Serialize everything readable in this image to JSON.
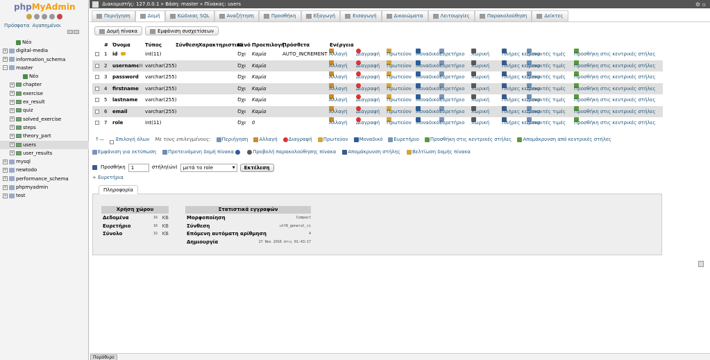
{
  "sidebar": {
    "logo_a": "php",
    "logo_b": "MyAdmin",
    "recent": "Πρόσφατα",
    "favorites": "Αγαπημένοι",
    "tree": [
      {
        "label": "Νέο",
        "type": "new",
        "depth": 1,
        "toggle": ""
      },
      {
        "label": "digital-media",
        "type": "db",
        "depth": 0,
        "toggle": "+"
      },
      {
        "label": "information_schema",
        "type": "db",
        "depth": 0,
        "toggle": "+"
      },
      {
        "label": "master",
        "type": "db",
        "depth": 0,
        "toggle": "−"
      },
      {
        "label": "Νέο",
        "type": "new",
        "depth": 2,
        "toggle": ""
      },
      {
        "label": "chapter",
        "type": "tb",
        "depth": 1,
        "toggle": "+"
      },
      {
        "label": "exercise",
        "type": "tb",
        "depth": 1,
        "toggle": "+"
      },
      {
        "label": "ex_result",
        "type": "tb",
        "depth": 1,
        "toggle": "+"
      },
      {
        "label": "quiz",
        "type": "tb",
        "depth": 1,
        "toggle": "+"
      },
      {
        "label": "solved_exercise",
        "type": "tb",
        "depth": 1,
        "toggle": "+"
      },
      {
        "label": "steps",
        "type": "tb",
        "depth": 1,
        "toggle": "+"
      },
      {
        "label": "theory_part",
        "type": "tb",
        "depth": 1,
        "toggle": "+"
      },
      {
        "label": "users",
        "type": "tb",
        "depth": 1,
        "toggle": "+",
        "selected": true
      },
      {
        "label": "user_results",
        "type": "tb",
        "depth": 1,
        "toggle": "+"
      },
      {
        "label": "mysql",
        "type": "db",
        "depth": 0,
        "toggle": "+"
      },
      {
        "label": "newtodo",
        "type": "db",
        "depth": 0,
        "toggle": "+"
      },
      {
        "label": "performance_schema",
        "type": "db",
        "depth": 0,
        "toggle": "+"
      },
      {
        "label": "phpmyadmin",
        "type": "db",
        "depth": 0,
        "toggle": "+"
      },
      {
        "label": "test",
        "type": "db",
        "depth": 0,
        "toggle": "+"
      }
    ]
  },
  "breadcrumb": {
    "server": "Διακομιστής: 127.0.0.1",
    "sep1": "»",
    "db": "Βάση: master",
    "sep2": "»",
    "table": "Πίνακας: users"
  },
  "tabs": [
    "Περιήγηση",
    "Δομή",
    "Κώδικας SQL",
    "Αναζήτηση",
    "Προσθήκη",
    "Εξαγωγή",
    "Εισαγωγή",
    "Δικαιώματα",
    "Λειτουργίες",
    "Παρακολούθηση",
    "Δείκτες"
  ],
  "subtabs": [
    "Δομή πίνακα",
    "Εμφάνιση συσχετίσεων"
  ],
  "columns": {
    "num": "#",
    "name": "Όνομα",
    "type": "Τύπος",
    "collation": "Σύνθεση",
    "attributes": "Χαρακτηριστικά",
    "null": "Κενό",
    "default": "Προεπιλογή",
    "extra": "Πρόσθετα",
    "action": "Ενέργεια"
  },
  "actions": [
    "Αλλαγή",
    "Διαγραφή",
    "Πρωτεύον",
    "Μοναδικό",
    "Ευρετήριο",
    "Χωρική",
    "Πλήρες κείμενο",
    "Διακριτές τιμές",
    "Προσθήκη στις κεντρικές στήλες"
  ],
  "rows": [
    {
      "num": "1",
      "name": "id",
      "type": "int(11)",
      "null": "Όχι",
      "default": "Καμία",
      "extra": "AUTO_INCREMENT",
      "key": "primary"
    },
    {
      "num": "2",
      "name": "username",
      "type": "varchar(255)",
      "null": "Όχι",
      "default": "Καμία",
      "extra": "",
      "key": "index"
    },
    {
      "num": "3",
      "name": "password",
      "type": "varchar(255)",
      "null": "Όχι",
      "default": "Καμία",
      "extra": "",
      "key": ""
    },
    {
      "num": "4",
      "name": "firstname",
      "type": "varchar(255)",
      "null": "Όχι",
      "default": "Καμία",
      "extra": "",
      "key": ""
    },
    {
      "num": "5",
      "name": "lastname",
      "type": "varchar(255)",
      "null": "Όχι",
      "default": "Καμία",
      "extra": "",
      "key": ""
    },
    {
      "num": "6",
      "name": "email",
      "type": "varchar(255)",
      "null": "Όχι",
      "default": "Καμία",
      "extra": "",
      "key": ""
    },
    {
      "num": "7",
      "name": "role",
      "type": "int(11)",
      "null": "Όχι",
      "default": "0",
      "extra": "",
      "key": ""
    }
  ],
  "selection": {
    "check_all": "Επιλογή όλων",
    "with_selected": "Με τους επιλεγμένους:",
    "browse": "Περιήγηση",
    "change": "Αλλαγή",
    "drop": "Διαγραφή",
    "primary": "Πρωτεύον",
    "unique": "Μοναδικό",
    "index": "Ευρετήριο",
    "add_central": "Προσθήκη στις κεντρικές στήλες",
    "remove_central": "Απομάκρυνση από κεντρικές στήλες"
  },
  "operations": [
    "Εμφάνιση για εκτύπωση",
    "Προτεινόμενη δομή πίνακα",
    "Προβολή παρακολούθησης πίνακα",
    "Απομάκρυνση στήλης",
    "Βελτίωση δομής πίνακα"
  ],
  "add": {
    "label": "Προσθήκη",
    "count": "1",
    "suffix": "στήλη(ών)",
    "position": "μετά το role",
    "go": "Εκτέλεση"
  },
  "indexes": "+ Ευρετήρια",
  "info": {
    "tab": "Πληροφορία",
    "space_title": "Χρήση χώρου",
    "space": [
      {
        "k": "Δεδομένα",
        "v": "16",
        "u": "KB"
      },
      {
        "k": "Ευρετήριο",
        "v": "16",
        "u": "KB"
      },
      {
        "k": "Σύνολο",
        "v": "32",
        "u": "KB"
      }
    ],
    "stats_title": "Στατιστικά εγγραφών",
    "stats": [
      {
        "k": "Μορφοποίηση",
        "v": "Compact"
      },
      {
        "k": "Σύνθεση",
        "v": "utf8_general_ci"
      },
      {
        "k": "Επόμενη αυτόματη αρίθμηση",
        "v": "4"
      },
      {
        "k": "Δημιουργία",
        "v": "27 Νοε 2016 στις 01:43:17"
      }
    ]
  },
  "console": "Παράθυρο"
}
